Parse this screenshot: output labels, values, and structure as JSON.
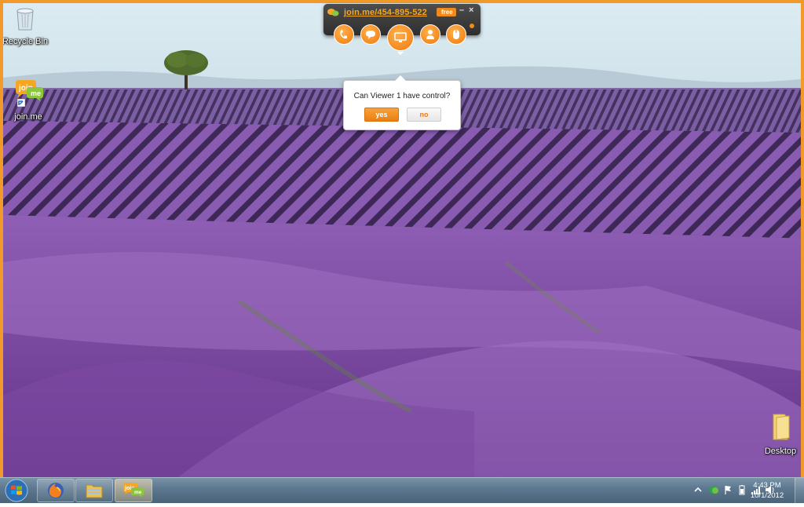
{
  "desktop": {
    "icons": [
      {
        "label": "Recycle Bin"
      },
      {
        "label": "join.me"
      },
      {
        "label": "Desktop"
      }
    ]
  },
  "joinme_toolbar": {
    "code_link": "join.me/454-895-522",
    "badge": "free",
    "minimize_label": "–",
    "close_label": "×",
    "buttons": [
      "phone-icon",
      "chat-icon",
      "screen-share-icon",
      "viewers-icon",
      "mouse-control-icon"
    ]
  },
  "control_popup": {
    "question": "Can Viewer 1 have control?",
    "yes_label": "yes",
    "no_label": "no"
  },
  "taskbar": {
    "items": [
      "firefox-icon",
      "windows-explorer-icon",
      "joinme-icon"
    ],
    "clock": {
      "time": "4:43 PM",
      "date": "10/1/2012"
    }
  },
  "colors": {
    "accent": "#f08a1c",
    "frame_border": "#f19a29",
    "lavender": "#7a4a9a"
  }
}
